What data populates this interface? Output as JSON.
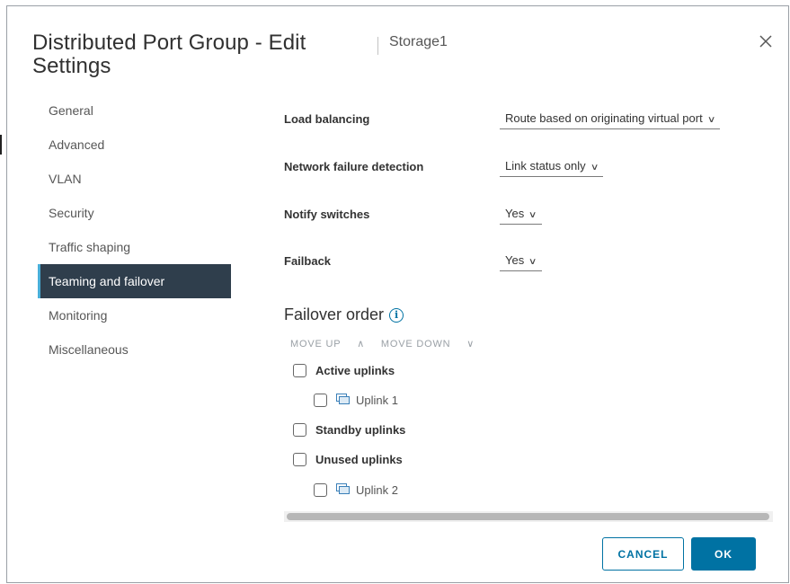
{
  "header": {
    "title": "Distributed Port Group - Edit Settings",
    "subtitle": "Storage1"
  },
  "sidebar": {
    "items": [
      {
        "label": "General"
      },
      {
        "label": "Advanced"
      },
      {
        "label": "VLAN"
      },
      {
        "label": "Security"
      },
      {
        "label": "Traffic shaping"
      },
      {
        "label": "Teaming and failover",
        "active": true
      },
      {
        "label": "Monitoring"
      },
      {
        "label": "Miscellaneous"
      }
    ]
  },
  "form": {
    "load_balancing": {
      "label": "Load balancing",
      "value": "Route based on originating virtual port"
    },
    "network_failure_detection": {
      "label": "Network failure detection",
      "value": "Link status only"
    },
    "notify_switches": {
      "label": "Notify switches",
      "value": "Yes"
    },
    "failback": {
      "label": "Failback",
      "value": "Yes"
    }
  },
  "failover": {
    "title": "Failover order",
    "move_up": "MOVE UP",
    "move_down": "MOVE DOWN",
    "groups": {
      "active": "Active uplinks",
      "active_child": "Uplink 1",
      "standby": "Standby uplinks",
      "unused": "Unused uplinks",
      "unused_child": "Uplink 2"
    }
  },
  "footer": {
    "cancel": "CANCEL",
    "ok": "OK"
  },
  "colors": {
    "accent": "#0072a3",
    "active_nav_bg": "#2f3e4c",
    "active_nav_border": "#49afd9"
  }
}
